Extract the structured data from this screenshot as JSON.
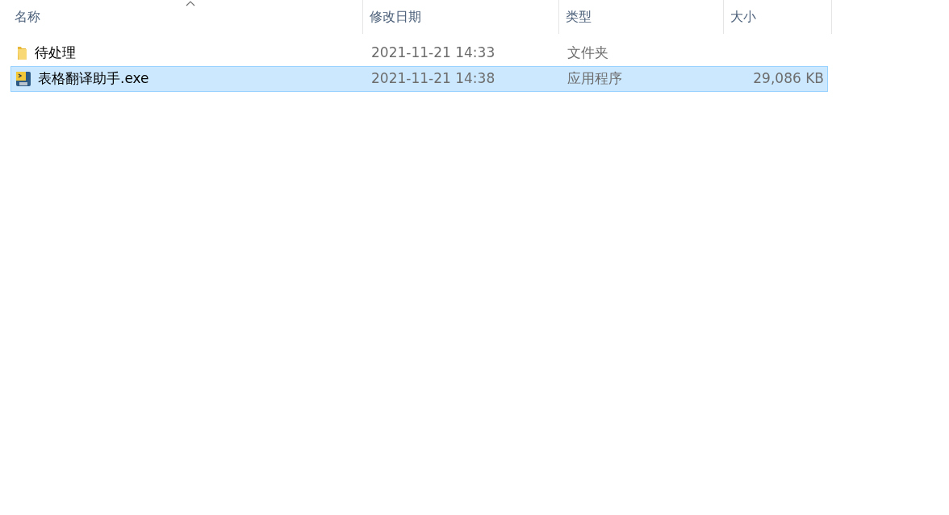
{
  "columns": [
    {
      "label": "名称",
      "sorted": true
    },
    {
      "label": "修改日期",
      "sorted": false
    },
    {
      "label": "类型",
      "sorted": false
    },
    {
      "label": "大小",
      "sorted": false
    }
  ],
  "rows": [
    {
      "kind": "folder",
      "name": "待处理",
      "modified": "2021-11-21 14:33",
      "type": "文件夹",
      "selected": false
    },
    {
      "kind": "app",
      "name": "表格翻译助手.exe",
      "modified": "2021-11-21 14:38",
      "type": "应用程序",
      "size": "29,086 KB",
      "selected": true
    }
  ]
}
